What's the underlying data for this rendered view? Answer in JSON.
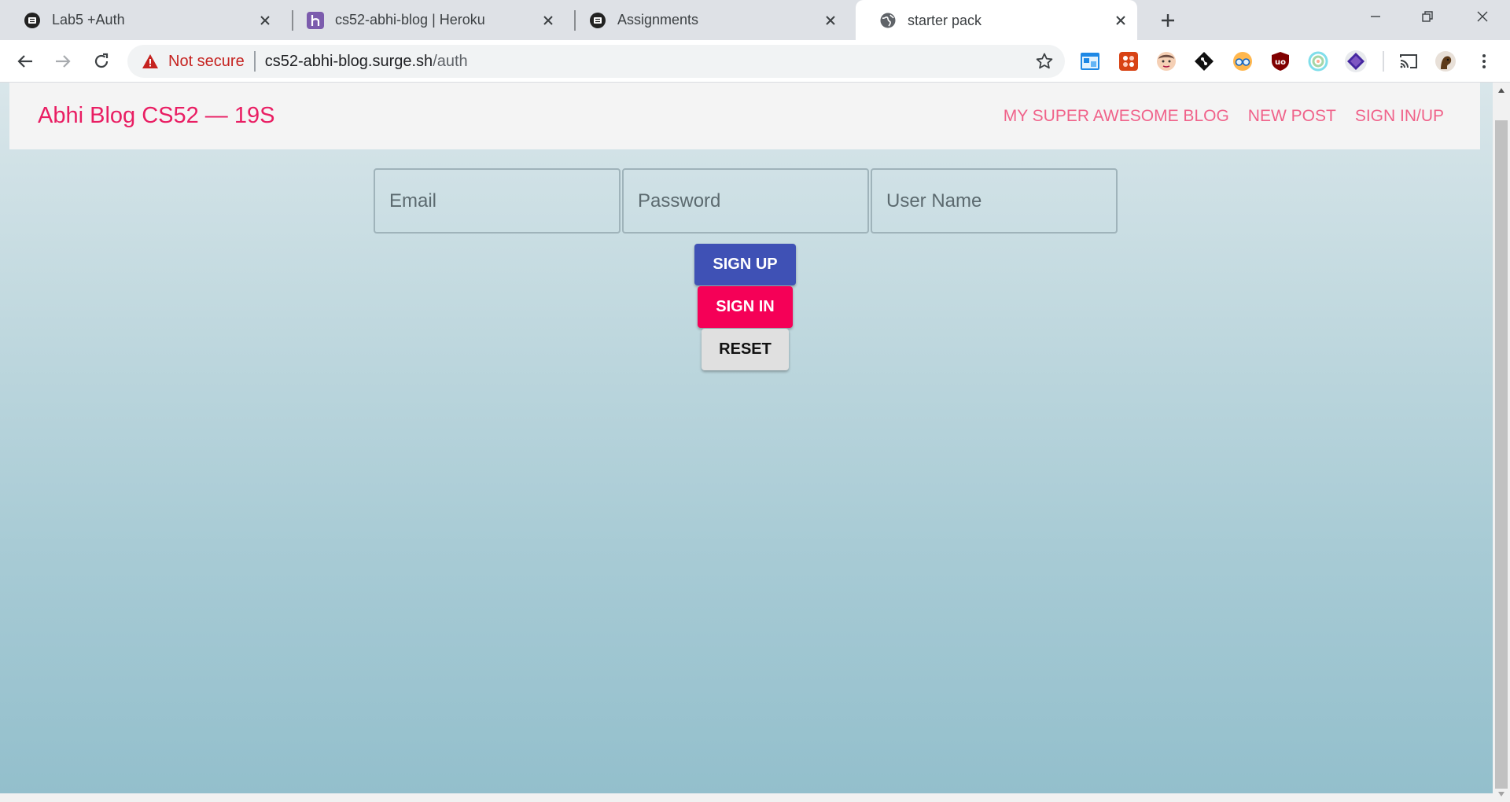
{
  "tabs": [
    {
      "title": "Lab5 +Auth",
      "favicon": "canvas-icon",
      "active": false
    },
    {
      "title": "cs52-abhi-blog | Heroku",
      "favicon": "heroku-icon",
      "active": false
    },
    {
      "title": "Assignments",
      "favicon": "canvas-icon",
      "active": false
    },
    {
      "title": "starter pack",
      "favicon": "globe-icon",
      "active": true
    }
  ],
  "address_bar": {
    "security_label": "Not secure",
    "url_host": "cs52-abhi-blog.surge.sh",
    "url_path": "/auth"
  },
  "extensions": [
    "window-ext-icon",
    "puzzle-ext-icon",
    "avatar-ext-icon",
    "git-ext-icon",
    "glasses-ext-icon",
    "ublock-ext-icon",
    "circle-ext-icon",
    "diamond-ext-icon"
  ],
  "app": {
    "brand": "Abhi Blog CS52 — 19S",
    "nav": {
      "blog": "MY SUPER AWESOME BLOG",
      "new_post": "NEW POST",
      "sign_in_up": "SIGN IN/UP"
    }
  },
  "auth_form": {
    "email_placeholder": "Email",
    "password_placeholder": "Password",
    "username_placeholder": "User Name",
    "email_value": "",
    "password_value": "",
    "username_value": "",
    "sign_up_label": "SIGN UP",
    "sign_in_label": "SIGN IN",
    "reset_label": "RESET"
  },
  "colors": {
    "brand": "#e91e63",
    "nav_link": "#f0628a",
    "sign_up": "#3f51b5",
    "sign_in": "#f50057",
    "reset": "#e0e0e0"
  }
}
